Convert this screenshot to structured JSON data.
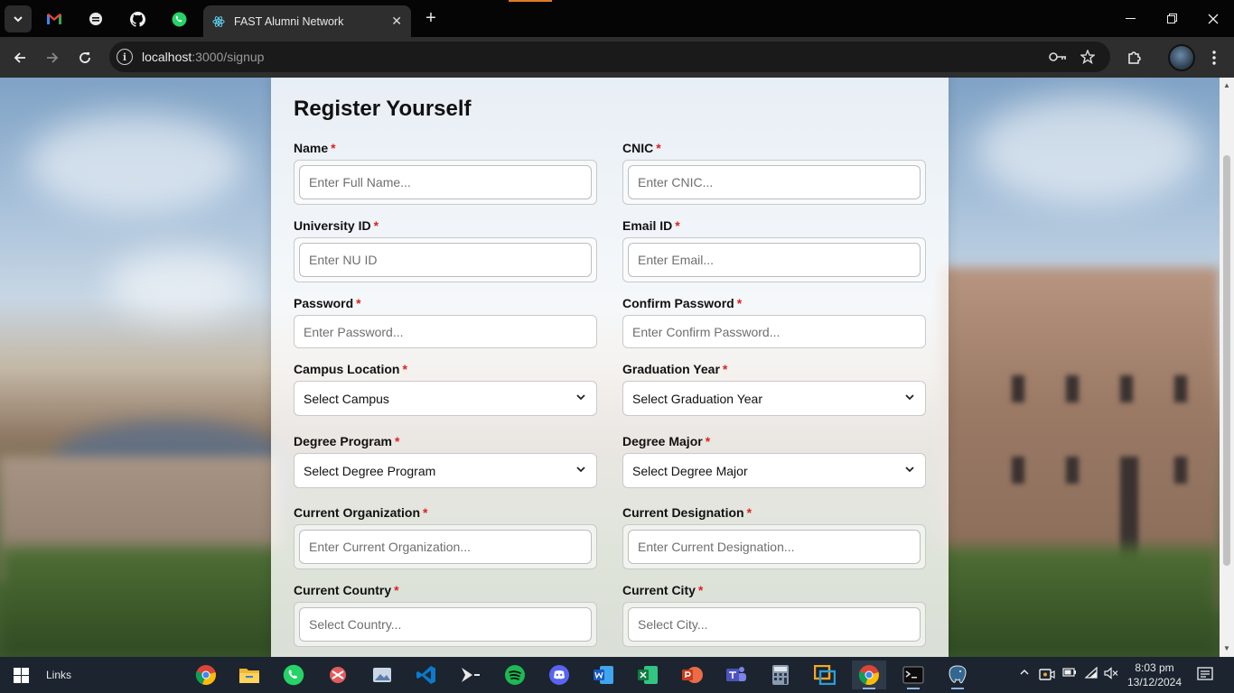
{
  "browser": {
    "active_tab_title": "FAST Alumni Network",
    "new_tab_symbol": "+",
    "close_tab_symbol": "✕",
    "url_host": "localhost",
    "url_path": ":3000/signup",
    "pinned_tabs": [
      "gmail-icon",
      "tab-icon",
      "github-icon",
      "whatsapp-icon"
    ]
  },
  "form": {
    "title": "Register Yourself",
    "required_mark": "*",
    "name": {
      "label": "Name",
      "placeholder": "Enter Full Name..."
    },
    "cnic": {
      "label": "CNIC",
      "placeholder": "Enter CNIC..."
    },
    "university_id": {
      "label": "University ID",
      "placeholder": "Enter NU ID"
    },
    "email": {
      "label": "Email ID",
      "placeholder": "Enter Email..."
    },
    "password": {
      "label": "Password",
      "placeholder": "Enter Password..."
    },
    "confirm_password": {
      "label": "Confirm Password",
      "placeholder": "Enter Confirm Password..."
    },
    "campus": {
      "label": "Campus Location",
      "value": "Select Campus"
    },
    "graduation_year": {
      "label": "Graduation Year",
      "value": "Select Graduation Year"
    },
    "degree_program": {
      "label": "Degree Program",
      "value": "Select Degree Program"
    },
    "degree_major": {
      "label": "Degree Major",
      "value": "Select Degree Major"
    },
    "organization": {
      "label": "Current Organization",
      "placeholder": "Enter Current Organization..."
    },
    "designation": {
      "label": "Current Designation",
      "placeholder": "Enter Current Designation..."
    },
    "country": {
      "label": "Current Country",
      "placeholder": "Select Country..."
    },
    "city": {
      "label": "Current City",
      "placeholder": "Select City..."
    }
  },
  "taskbar": {
    "links_label": "Links",
    "time": "8:03 pm",
    "date": "13/12/2024"
  },
  "colors": {
    "required": "#dd2222",
    "browser_bg": "#050505",
    "toolbar_bg": "#2e2e2e",
    "taskbar_bg": "#1c2430"
  }
}
